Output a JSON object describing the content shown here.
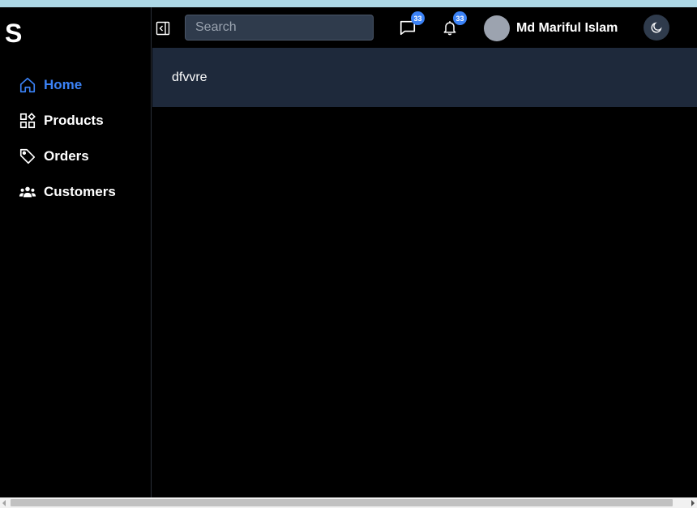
{
  "sidebar": {
    "logo": "S",
    "items": [
      {
        "label": "Home",
        "icon": "home-icon",
        "active": true
      },
      {
        "label": "Products",
        "icon": "grid-icon",
        "active": false
      },
      {
        "label": "Orders",
        "icon": "tag-icon",
        "active": false
      },
      {
        "label": "Customers",
        "icon": "users-icon",
        "active": false
      }
    ]
  },
  "header": {
    "search_placeholder": "Search",
    "messages_count": "33",
    "notifications_count": "33",
    "user_name": "Md Mariful Islam",
    "theme_icon": "moon-icon"
  },
  "main": {
    "content_text": "dfvvre"
  },
  "colors": {
    "accent": "#3b82f6",
    "background": "#000000",
    "card": "#1e293b",
    "top_strip": "#add8e6"
  }
}
